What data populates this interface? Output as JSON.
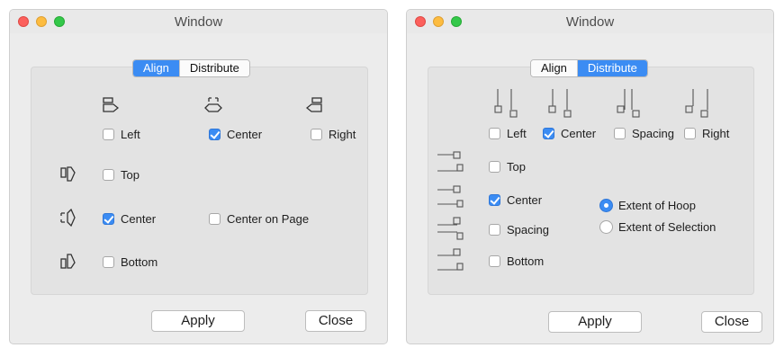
{
  "windows": [
    {
      "title": "Window",
      "tabs": [
        {
          "label": "Align",
          "active": true
        },
        {
          "label": "Distribute",
          "active": false
        }
      ],
      "horizontal": [
        {
          "label": "Left",
          "checked": false,
          "icon": "align-left-icon"
        },
        {
          "label": "Center",
          "checked": true,
          "icon": "align-center-h-icon"
        },
        {
          "label": "Right",
          "checked": false,
          "icon": "align-right-icon"
        }
      ],
      "vertical": [
        {
          "label": "Top",
          "checked": false,
          "icon": "align-top-icon"
        },
        {
          "label": "Center",
          "checked": true,
          "icon": "align-center-v-icon"
        },
        {
          "label": "Bottom",
          "checked": false,
          "icon": "align-bottom-icon"
        }
      ],
      "center_on_page": {
        "label": "Center on Page",
        "checked": false
      },
      "buttons": {
        "apply": "Apply",
        "close": "Close"
      }
    },
    {
      "title": "Window",
      "tabs": [
        {
          "label": "Align",
          "active": false
        },
        {
          "label": "Distribute",
          "active": true
        }
      ],
      "horizontal": [
        {
          "label": "Left",
          "checked": false,
          "icon": "distribute-left-icon"
        },
        {
          "label": "Center",
          "checked": true,
          "icon": "distribute-center-h-icon"
        },
        {
          "label": "Spacing",
          "checked": false,
          "icon": "distribute-spacing-h-icon"
        },
        {
          "label": "Right",
          "checked": false,
          "icon": "distribute-right-icon"
        }
      ],
      "vertical": [
        {
          "label": "Top",
          "checked": false,
          "icon": "distribute-top-icon"
        },
        {
          "label": "Center",
          "checked": true,
          "icon": "distribute-center-v-icon"
        },
        {
          "label": "Spacing",
          "checked": false,
          "icon": "distribute-spacing-v-icon"
        },
        {
          "label": "Bottom",
          "checked": false,
          "icon": "distribute-bottom-icon"
        }
      ],
      "extent": [
        {
          "label": "Extent of Hoop",
          "selected": true
        },
        {
          "label": "Extent of Selection",
          "selected": false
        }
      ],
      "buttons": {
        "apply": "Apply",
        "close": "Close"
      }
    }
  ],
  "colors": {
    "accent": "#3b8cf3",
    "window_bg": "#ececec",
    "panel_bg": "#e3e3e3",
    "close_light": "#fc605c",
    "minimize_light": "#fdbc40",
    "zoom_light": "#34c84a"
  }
}
